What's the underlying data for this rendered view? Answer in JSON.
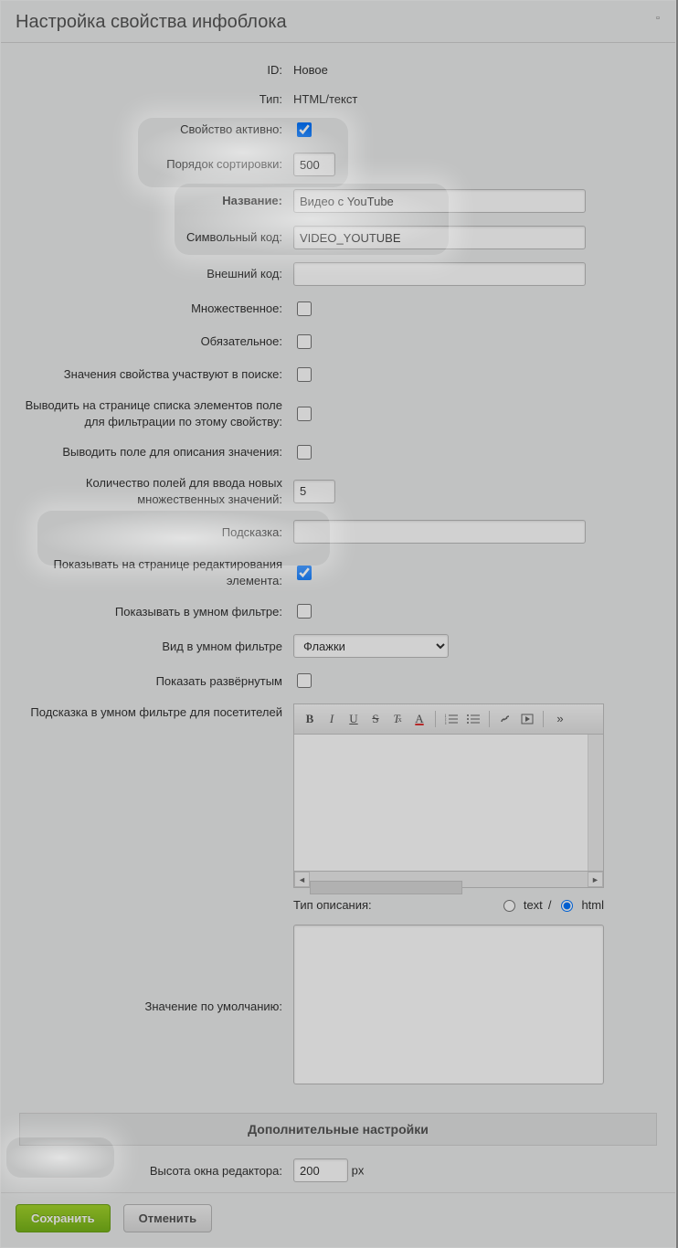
{
  "title": "Настройка свойства инфоблока",
  "fields": {
    "id_label": "ID:",
    "id_value": "Новое",
    "type_label": "Тип:",
    "type_value": "HTML/текст",
    "active_label": "Свойство активно:",
    "active_checked": true,
    "sort_label": "Порядок сортировки:",
    "sort_value": "500",
    "name_label": "Название:",
    "name_value": "Видео с YouTube",
    "code_label": "Символьный код:",
    "code_value": "VIDEO_YOUTUBE",
    "xml_label": "Внешний код:",
    "xml_value": "",
    "multiple_label": "Множественное:",
    "multiple_checked": false,
    "required_label": "Обязательное:",
    "required_checked": false,
    "searchable_label": "Значения свойства участвуют в поиске:",
    "searchable_checked": false,
    "filtrable_label": "Выводить на странице списка элементов поле для фильтрации по этому свойству:",
    "filtrable_checked": false,
    "withdesc_label": "Выводить поле для описания значения:",
    "withdesc_checked": false,
    "multcnt_label": "Количество полей для ввода новых множественных значений:",
    "multcnt_value": "5",
    "hint_label": "Подсказка:",
    "hint_value": "",
    "showedit_label": "Показывать на странице редактирования элемента:",
    "showedit_checked": true,
    "smartfilter_label": "Показывать в умном фильтре:",
    "smartfilter_checked": false,
    "smartfilter_view_label": "Вид в умном фильтре",
    "smartfilter_view_value": "Флажки",
    "smartfilter_view_options": [
      "Флажки"
    ],
    "expanded_label": "Показать развёрнутым",
    "expanded_checked": false,
    "filterhint_label": "Подсказка в умном фильтре для посетителей",
    "desc_type_label": "Тип описания:",
    "desc_type_text": "text",
    "desc_type_html": "html",
    "desc_type_sep": " / ",
    "desc_type_selected": "html",
    "default_label": "Значение по умолчанию:",
    "default_value": "",
    "section_extra": "Дополнительные настройки",
    "editor_height_label": "Высота окна редактора:",
    "editor_height_value": "200",
    "editor_height_unit": "px"
  },
  "footer": {
    "save": "Сохранить",
    "cancel": "Отменить"
  }
}
